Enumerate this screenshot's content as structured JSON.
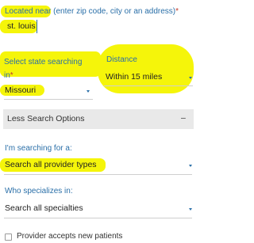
{
  "location": {
    "label_main": "Located near",
    "label_hint": " (enter zip code, city or an address)",
    "required_mark": "*",
    "value": "st. louis"
  },
  "state": {
    "label_line1": "Select state searching",
    "label_line2": "in",
    "required_mark": "*",
    "value": "Missouri"
  },
  "distance": {
    "label": "Distance",
    "value": "Within 15 miles"
  },
  "less_options": {
    "label": "Less Search Options",
    "toggle_symbol": "–"
  },
  "provider_type": {
    "label": "I'm searching for a:",
    "value": "Search all provider types"
  },
  "specialty": {
    "label": "Who specializes in:",
    "value": "Search all specialties"
  },
  "new_patients": {
    "label": "Provider accepts new patients",
    "checked": false
  },
  "colors": {
    "highlight": "#f5f50a",
    "label_blue": "#2a6fa8",
    "required_red": "#c0392b",
    "bar_bg": "#e9e9e9"
  }
}
